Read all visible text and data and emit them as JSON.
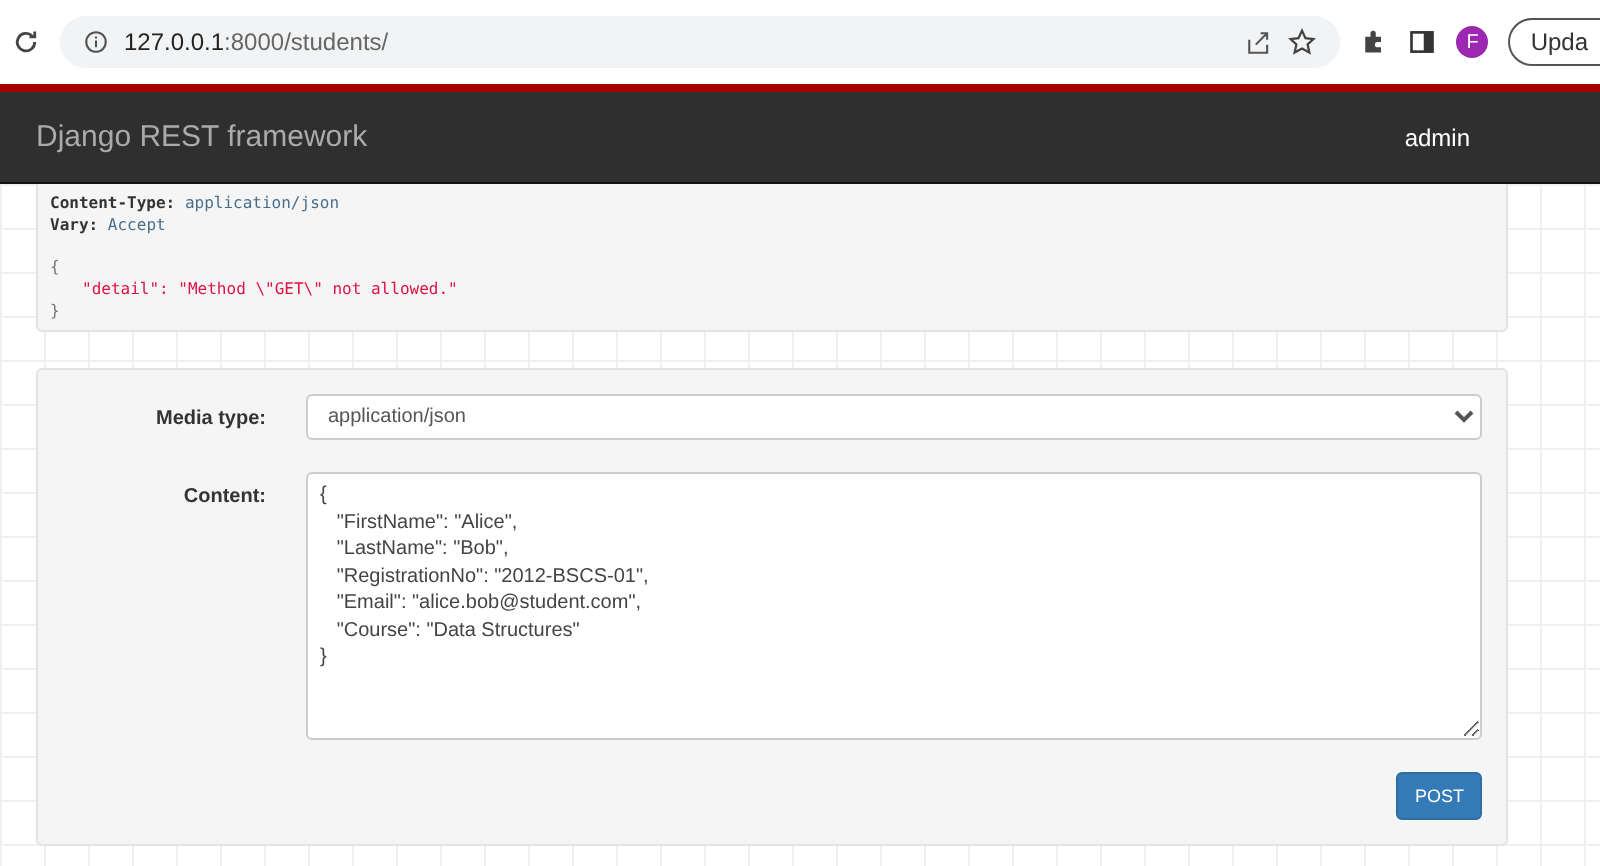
{
  "browser": {
    "url_host": "127.0.0.1",
    "url_path": ":8000/students/",
    "profile": "F",
    "update_button": "Upda"
  },
  "navbar": {
    "brand": "Django REST framework",
    "user": "admin"
  },
  "response": {
    "headers": [
      {
        "name": "Content-Type:",
        "value": "application/json"
      },
      {
        "name": "Vary:",
        "value": "Accept"
      }
    ],
    "body": [
      {
        "kind": "brace",
        "text": "{"
      },
      {
        "kind": "entry",
        "text": "\"detail\": \"Method \\\"GET\\\" not allowed.\""
      },
      {
        "kind": "brace",
        "text": "}"
      }
    ]
  },
  "form": {
    "media_type": {
      "label": "Media type:",
      "value": "application/json"
    },
    "content": {
      "label": "Content:",
      "lines": [
        "{",
        "   \"FirstName\": \"Alice\",",
        "   \"LastName\": \"Bob\",",
        "   \"RegistrationNo\": \"2012-BSCS-01\",",
        "   \"Email\": \"alice.bob@student.com\",",
        "   \"Course\": \"Data Structures\"",
        "}"
      ]
    },
    "submit": "POST"
  }
}
